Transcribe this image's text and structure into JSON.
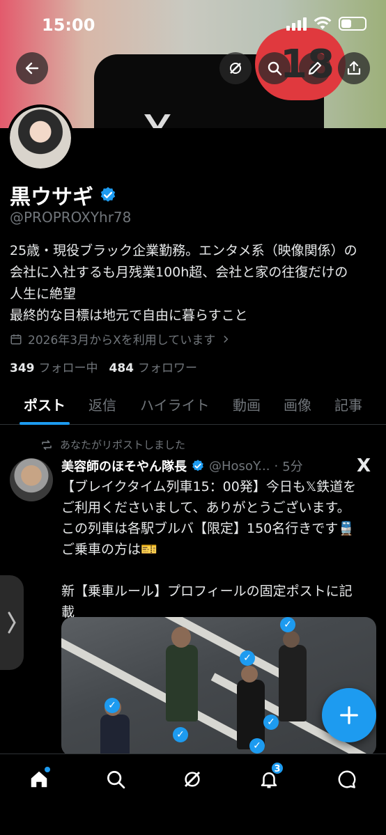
{
  "status_bar": {
    "time": "15:00"
  },
  "banner": {
    "badge_count": "18"
  },
  "profile": {
    "display_name": "黒ウサギ",
    "handle": "@PROPROXYhr78",
    "bio_lines": [
      "25歳・現役ブラック企業勤務。エンタメ系（映像関係）の",
      "会社に入社するも月残業100h超、会社と家の往復だけの",
      "人生に絶望",
      "最終的な目標は地元で自由に暮らすこと"
    ],
    "joined": "2026年3月からXを利用しています",
    "following_count": "349",
    "following_label": "フォロー中",
    "followers_count": "484",
    "followers_label": "フォロワー"
  },
  "tabs": [
    {
      "label": "ポスト",
      "active": true
    },
    {
      "label": "返信",
      "active": false
    },
    {
      "label": "ハイライト",
      "active": false
    },
    {
      "label": "動画",
      "active": false
    },
    {
      "label": "画像",
      "active": false
    },
    {
      "label": "記事",
      "active": false
    }
  ],
  "post": {
    "repost_label": "あなたがリポストしました",
    "author_name": "美容師のほそやん隊長",
    "author_handle": "@HosoY...",
    "time": "5分",
    "source_mark": "X",
    "text_lines": [
      "【ブレイクタイム列車15：00発】今日も𝕏鉄道を",
      "ご利用くださいまして、ありがとうございます。",
      "この列車は各駅ブルバ【限定】150名行きです🚆",
      "ご乗車の方は🎫",
      "",
      "新【乗車ルール】プロフィールの固定ポストに記",
      "載"
    ]
  },
  "bottom_nav": {
    "notifications_badge": "3"
  },
  "colors": {
    "accent": "#1d9bf0",
    "muted": "#71767b",
    "background": "#000000"
  }
}
